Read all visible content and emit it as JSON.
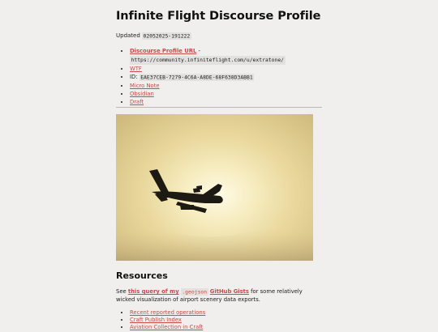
{
  "page": {
    "title": "Infinite Flight Discourse Profile",
    "updated_label": "Updated",
    "updated_value": "02052025-191222"
  },
  "links": {
    "profile_label": "Discourse Profile URL",
    "profile_sep": " -",
    "profile_url": "https://community.infiniteflight.com/u/extratone/",
    "wtf": "WTF",
    "id_label": "ID:",
    "id_value": "EAE37CEB-7279-4C6A-A8DE-68F638D3ABB1",
    "micro_note": "Micro Note",
    "obsidian": "Obsidian",
    "draft": "Draft"
  },
  "image": {
    "subject": "airliner silhouette in hazy golden sky",
    "sky_colors": [
      "#fffbe6",
      "#f6ecbf",
      "#e8d69a",
      "#cdb77a"
    ],
    "plane_color": "#1c1a12"
  },
  "resources": {
    "heading": "Resources",
    "para_see": "See ",
    "para_link1": "this query of my",
    "para_code": ".geojson",
    "para_link2": "GitHub Gists",
    "para_rest": " for some relatively wicked visualization of airport scenery data exports.",
    "items": [
      "Recent reported operations",
      "Craft Publish Index",
      "Aviation Collection in Craft"
    ]
  },
  "colors": {
    "link": "#c94b4b",
    "background": "#f0efed",
    "code_bg": "#e2e1de"
  }
}
